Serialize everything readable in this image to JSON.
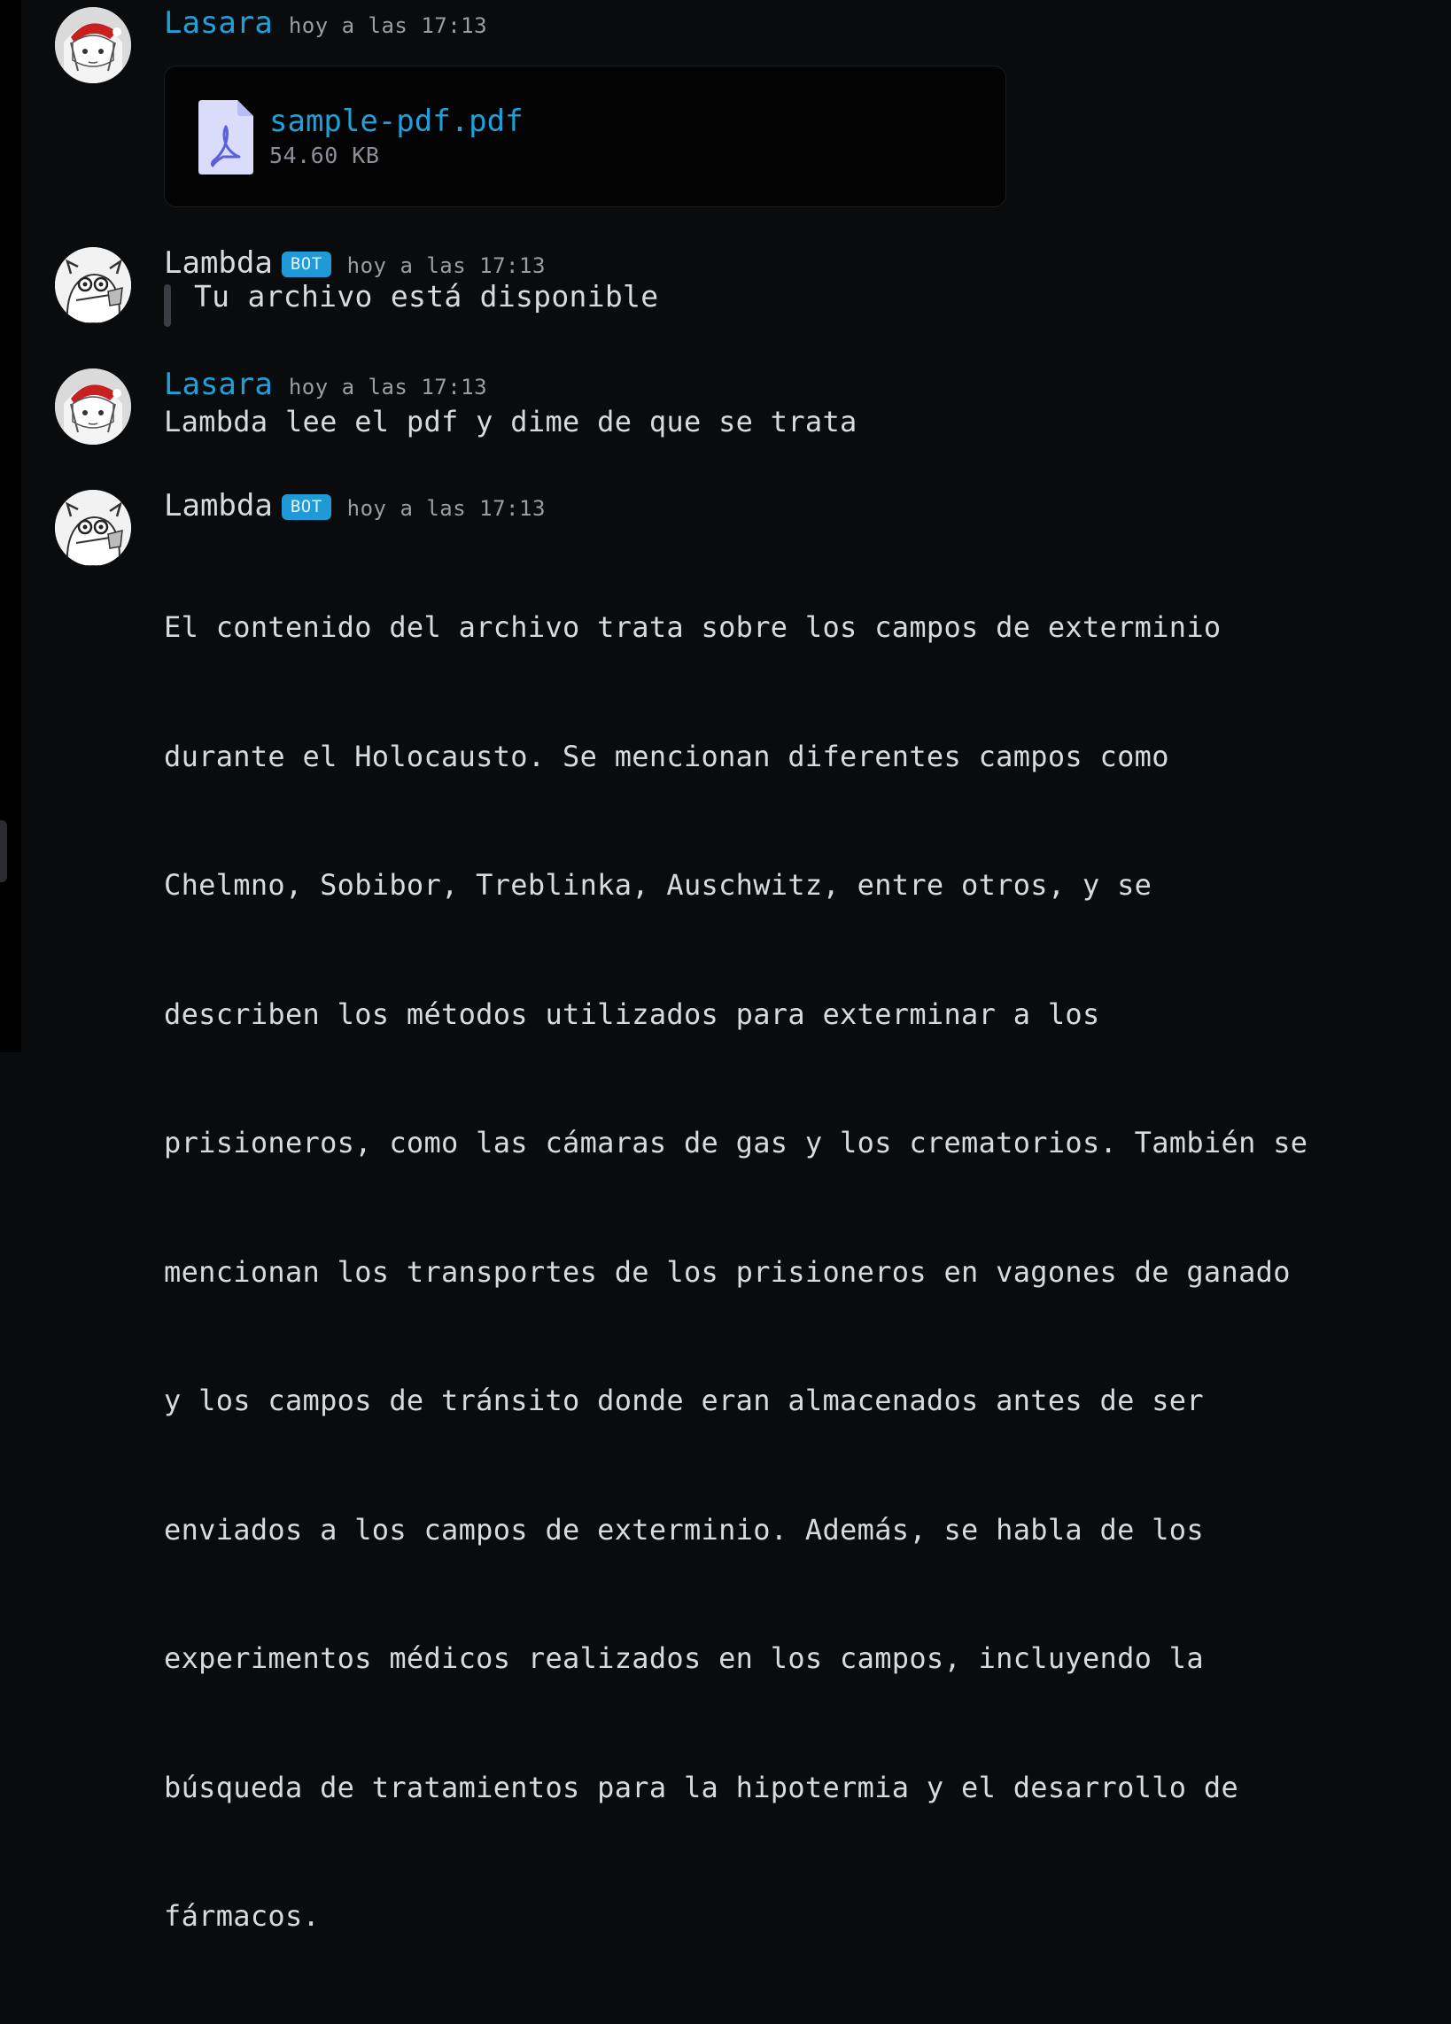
{
  "messages": [
    {
      "author": "Lasara",
      "time": "hoy a las 17:13",
      "attachment": {
        "name": "sample-pdf.pdf",
        "size": "54.60 KB",
        "icon": "pdf-file-icon"
      }
    },
    {
      "author": "Lambda",
      "badge": "BOT",
      "time": "hoy a las 17:13",
      "quote": "Tu archivo está disponible"
    },
    {
      "author": "Lasara",
      "time": "hoy a las 17:13",
      "text": "Lambda lee el pdf y dime de que se trata"
    },
    {
      "author": "Lambda",
      "badge": "BOT",
      "time": "hoy a las 17:13",
      "lines": [
        "El contenido del archivo trata sobre los campos de exterminio",
        "durante el Holocausto. Se mencionan diferentes campos como",
        "Chelmno, Sobibor, Treblinka, Auschwitz, entre otros, y se",
        "describen los métodos utilizados para exterminar a los",
        "prisioneros, como las cámaras de gas y los crematorios. También se",
        "mencionan los transportes de los prisioneros en vagones de ganado",
        "y los campos de tránsito donde eran almacenados antes de ser",
        "enviados a los campos de exterminio. Además, se habla de los",
        "experimentos médicos realizados en los campos, incluyendo la",
        "búsqueda de tratamientos para la hipotermia y el desarrollo de",
        "fármacos."
      ]
    }
  ],
  "colors": {
    "background": "#0a0b0c",
    "user_name": "#1ea0d8",
    "bot_badge": "#1f9ad6",
    "timestamp": "#9a9ea3"
  }
}
